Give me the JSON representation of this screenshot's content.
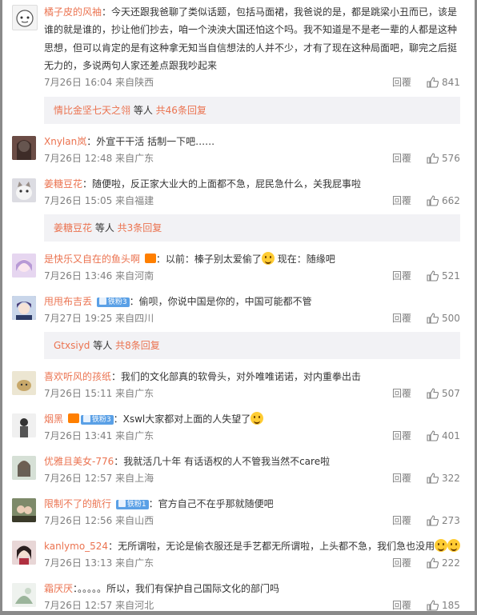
{
  "comments": [
    {
      "name": "橘子皮的风袖",
      "text": "今天还跟我爸聊了类似话题，包括马面裙，我爸说的是，都是跳梁小丑而已，该是谁的就是谁的，抄让他们抄去，咱一个泱泱大国还怕这个吗。我不知道是不是老一辈的人都是这种思想，但可以肯定的是有这种拿无知当自信想法的人并不少，才有了现在这种局面吧，聊完之后挺无力的，多说两句人家还差点跟我吵起来",
      "time": "7月26日 16:04",
      "source": "来自陕西",
      "reply": "回覆",
      "likes": "841",
      "sub": {
        "users": "情比金坚七天之翎",
        "suffix": " 等人",
        "more": "共46条回复"
      }
    },
    {
      "name": "Xnylan岚",
      "text": "外宣干干活 括制一下吧……",
      "time": "7月26日 12:48",
      "source": "来自广东",
      "reply": "回覆",
      "likes": "576"
    },
    {
      "name": "姜糖豆花",
      "text": "随便啦，反正家大业大的上面都不急，屁民急什么，关我屁事啦",
      "time": "7月26日 15:05",
      "source": "来自福建",
      "reply": "回覆",
      "likes": "662",
      "sub": {
        "users": "姜糖豆花",
        "suffix": " 等人",
        "more": "共3条回复"
      }
    },
    {
      "name": "是快乐又自在的鱼头啊",
      "text": "以前：榛子别太爱偷了",
      "text2": " 现在：随缘吧",
      "time": "7月26日 13:46",
      "source": "来自河南",
      "reply": "回覆",
      "likes": "521"
    },
    {
      "name": "甩甩布吉丢",
      "badge": "铁粉3",
      "text": "偷呗，你说中国是你的，中国可能都不管",
      "time": "7月27日 19:25",
      "source": "来自四川",
      "reply": "回覆",
      "likes": "500",
      "sub": {
        "users": "Gtxsiyd",
        "suffix": " 等人",
        "more": "共8条回复"
      }
    },
    {
      "name": "喜欢听风的孩纸",
      "text": "我们的文化部真的软骨头，对外唯唯诺诺，对内重拳出击",
      "time": "7月26日 15:11",
      "source": "来自广东",
      "reply": "回覆",
      "likes": "507"
    },
    {
      "name": "烟黑",
      "badge": "铁粉3",
      "text": "Xswl大家都对上面的人失望了",
      "time": "7月26日 13:41",
      "source": "来自广东",
      "reply": "回覆",
      "likes": "401"
    },
    {
      "name": "优雅且美女-776",
      "text": "我就活几十年 有话语权的人不管我当然不care啦",
      "time": "7月26日 12:57",
      "source": "来自上海",
      "reply": "回覆",
      "likes": "322"
    },
    {
      "name": "限制不了的航行",
      "badge": "铁粉1",
      "text": "官方自己不在乎那就随便吧",
      "time": "7月26日 12:56",
      "source": "来自山西",
      "reply": "回覆",
      "likes": "273"
    },
    {
      "name": "kanlymo_524",
      "text": "无所谓啦，无论是偷衣服还是手艺都无所谓啦，上头都不急，我们急也没用",
      "time": "7月26日 13:13",
      "source": "来自广东",
      "reply": "回覆",
      "likes": "222"
    },
    {
      "name": "霜厌厌",
      "text": "。。。。。所以，我们有保护自己国际文化的部门吗",
      "time": "7月26日 12:57",
      "source": "来自河北",
      "reply": "回覆",
      "likes": "185"
    }
  ],
  "colors": {
    "name": "#eb7350",
    "meta": "#808080",
    "subbox": "#f2f2f5",
    "badge": "#5aa0e6"
  }
}
